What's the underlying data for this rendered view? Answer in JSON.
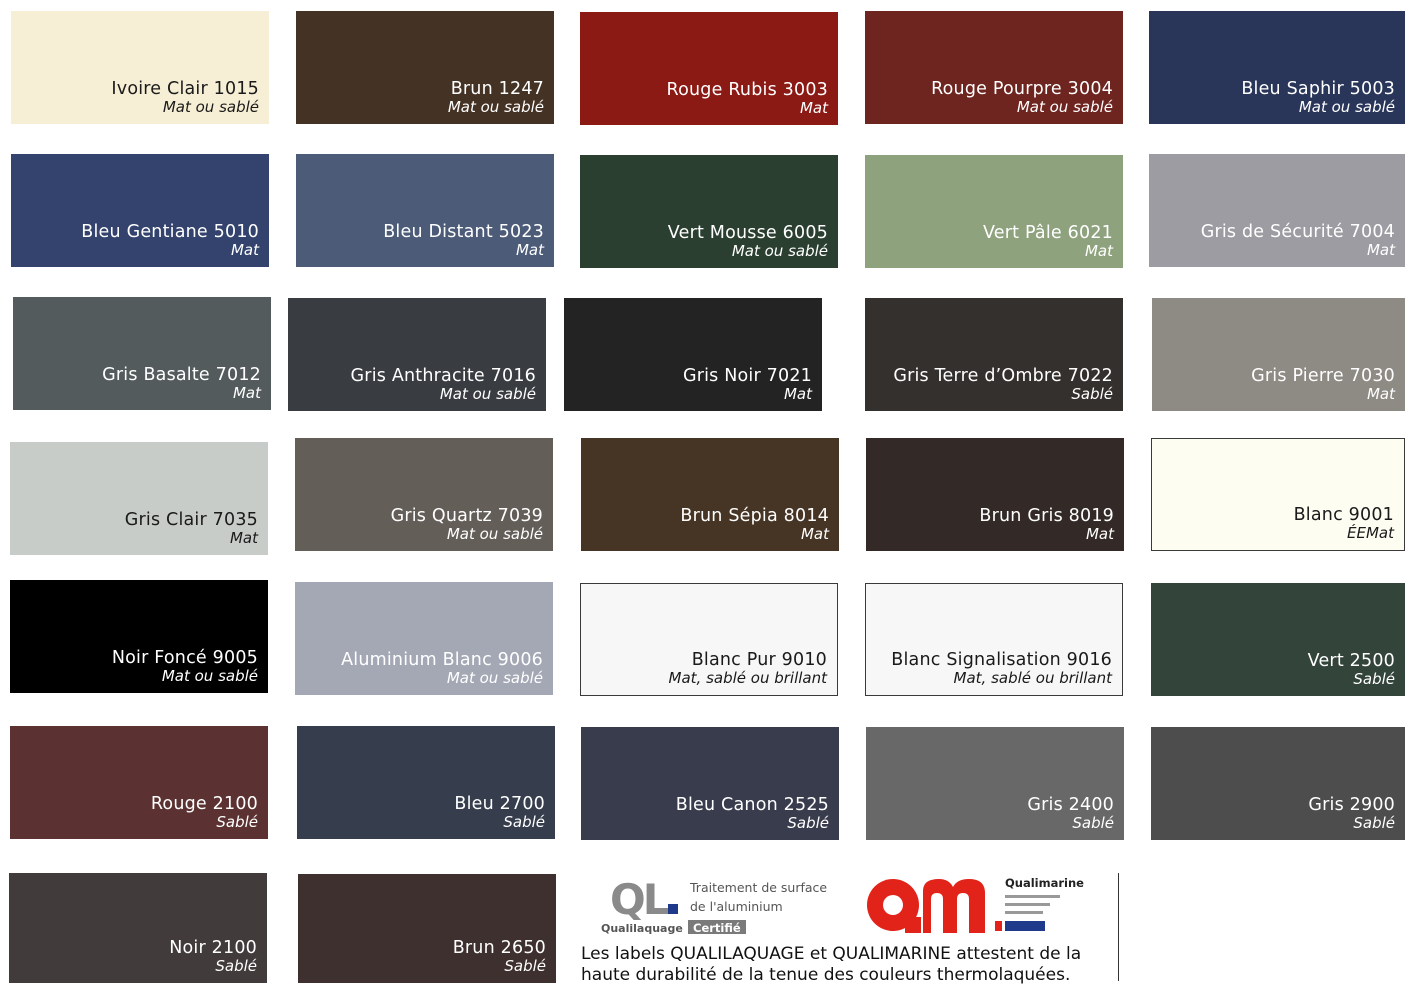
{
  "swatches": [
    {
      "name": "Ivoire Clair 1015",
      "finish": "Mat ou sablé",
      "color": "#f6eed5",
      "text": "light"
    },
    {
      "name": "Brun 1247",
      "finish": "Mat ou sablé",
      "color": "#443224",
      "text": "dark"
    },
    {
      "name": "Rouge Rubis 3003",
      "finish": "Mat",
      "color": "#8b1914",
      "text": "dark"
    },
    {
      "name": "Rouge Pourpre 3004",
      "finish": "Mat ou sablé",
      "color": "#6e241f",
      "text": "dark"
    },
    {
      "name": "Bleu Saphir 5003",
      "finish": "Mat ou sablé",
      "color": "#2a3659",
      "text": "dark"
    },
    {
      "name": "Bleu Gentiane 5010",
      "finish": "Mat",
      "color": "#33436d",
      "text": "dark"
    },
    {
      "name": "Bleu Distant 5023",
      "finish": "Mat",
      "color": "#4b5b78",
      "text": "dark"
    },
    {
      "name": "Vert Mousse 6005",
      "finish": "Mat ou sablé",
      "color": "#2b3f31",
      "text": "dark"
    },
    {
      "name": "Vert Pâle 6021",
      "finish": "Mat",
      "color": "#8fa27e",
      "text": "dark"
    },
    {
      "name": "Gris de Sécurité 7004",
      "finish": "Mat",
      "color": "#9c9ca2",
      "text": "dark"
    },
    {
      "name": "Gris Basalte 7012",
      "finish": "Mat",
      "color": "#545b5c",
      "text": "dark"
    },
    {
      "name": "Gris Anthracite 7016",
      "finish": "Mat ou sablé",
      "color": "#393c41",
      "text": "dark"
    },
    {
      "name": "Gris Noir 7021",
      "finish": "Mat",
      "color": "#232323",
      "text": "dark"
    },
    {
      "name": "Gris Terre d’Ombre 7022",
      "finish": "Sablé",
      "color": "#34302d",
      "text": "dark"
    },
    {
      "name": "Gris Pierre 7030",
      "finish": "Mat",
      "color": "#8e8a84",
      "text": "dark"
    },
    {
      "name": "Gris Clair 7035",
      "finish": "Mat",
      "color": "#c8ccc8",
      "text": "light"
    },
    {
      "name": "Gris Quartz 7039",
      "finish": "Mat ou sablé",
      "color": "#645e59",
      "text": "dark"
    },
    {
      "name": "Brun Sépia 8014",
      "finish": "Mat",
      "color": "#463524",
      "text": "dark"
    },
    {
      "name": "Brun Gris 8019",
      "finish": "Mat",
      "color": "#332a27",
      "text": "dark"
    },
    {
      "name": "Blanc 9001",
      "finish": "ÉEMat",
      "color": "#fdfdf2",
      "text": "light"
    },
    {
      "name": "Noir Foncé 9005",
      "finish": "Mat ou sablé",
      "color": "#000000",
      "text": "dark"
    },
    {
      "name": "Aluminium Blanc 9006",
      "finish": "Mat ou sablé",
      "color": "#a4a8b5",
      "text": "dark"
    },
    {
      "name": "Blanc Pur 9010",
      "finish": "Mat, sablé ou brillant",
      "color": "#f7f7f7",
      "text": "light"
    },
    {
      "name": "Blanc Signalisation 9016",
      "finish": "Mat, sablé ou brillant",
      "color": "#f7f7f7",
      "text": "light"
    },
    {
      "name": "Vert 2500",
      "finish": "Sablé",
      "color": "#33443a",
      "text": "dark"
    },
    {
      "name": "Rouge 2100",
      "finish": "Sablé",
      "color": "#5b3231",
      "text": "dark"
    },
    {
      "name": "Bleu 2700",
      "finish": "Sablé",
      "color": "#363d4d",
      "text": "dark"
    },
    {
      "name": "Bleu Canon 2525",
      "finish": "Sablé",
      "color": "#393c4c",
      "text": "dark"
    },
    {
      "name": "Gris 2400",
      "finish": "Sablé",
      "color": "#686868",
      "text": "dark"
    },
    {
      "name": "Gris 2900",
      "finish": "Sablé",
      "color": "#4d4d4d",
      "text": "dark"
    },
    {
      "name": "Noir 2100",
      "finish": "Sablé",
      "color": "#413b3b",
      "text": "dark"
    },
    {
      "name": "Brun 2650",
      "finish": "Sablé",
      "color": "#3d302f",
      "text": "dark"
    }
  ],
  "labels": {
    "qualilaquage": {
      "mark": "QL.",
      "line1": "Traitement de surface",
      "line2": "de l'aluminium",
      "name": "Qualilaquage",
      "badge": "Certifié"
    },
    "qualimarine": {
      "mark": "QM",
      "name": "Qualimarine"
    },
    "text_line1": "Les labels QUALILAQUAGE et QUALIMARINE attestent de la",
    "text_line2": "haute durabilité de la tenue des couleurs thermolaquées."
  },
  "colors": {
    "ql_grey": "#8a8a8a",
    "ql_blue": "#1f3a8a",
    "qm_red": "#e2231a",
    "badge_grey": "#7a7a7a"
  }
}
